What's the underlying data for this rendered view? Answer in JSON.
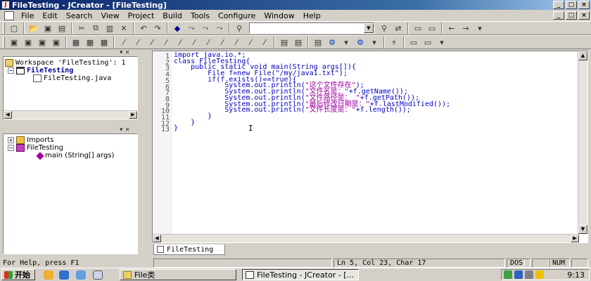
{
  "window": {
    "title": "FileTesting - JCreator - [FileTesting]",
    "min": "_",
    "max": "□",
    "close": "×"
  },
  "menu": [
    "File",
    "Edit",
    "Search",
    "View",
    "Project",
    "Build",
    "Tools",
    "Configure",
    "Window",
    "Help"
  ],
  "workspace_panel": {
    "root": "Workspace 'FileTesting': 1",
    "project": "FileTesting",
    "file": "FileTesting.java"
  },
  "class_panel": {
    "imports": "Imports",
    "class_name": "FileTesting",
    "method": "main (String[] args)"
  },
  "editor": {
    "line_numbers": [
      "1",
      "2",
      "3",
      "4",
      "5",
      "6",
      "7",
      "8",
      "9",
      "10",
      "11",
      "12",
      "13"
    ],
    "lines": [
      [
        {
          "t": "import java.io.*;",
          "c": "kw"
        }
      ],
      [
        {
          "t": "class FileTesting{",
          "c": "kw"
        }
      ],
      [
        {
          "t": "    public static void main(String args[]){",
          "c": "kw"
        }
      ],
      [
        {
          "t": "        File f=new File(\"/my/java1.txt\");",
          "c": "kw"
        }
      ],
      [
        {
          "t": "        if(f.exists()==true){",
          "c": "kw"
        }
      ],
      [
        {
          "t": "            System.out.println(",
          "c": "kw"
        },
        {
          "t": "\"这个文件存在\"",
          "c": "str"
        },
        {
          "t": ");",
          "c": "kw"
        }
      ],
      [
        {
          "t": "            System.out.println(",
          "c": "kw"
        },
        {
          "t": "\"文件名是：\"",
          "c": "str"
        },
        {
          "t": "+f.getName());",
          "c": "kw"
        }
      ],
      [
        {
          "t": "            System.out.println(",
          "c": "kw"
        },
        {
          "t": "\"文件路径是： \"",
          "c": "str"
        },
        {
          "t": "+f.getPath());",
          "c": "kw"
        }
      ],
      [
        {
          "t": "            System.out.println(",
          "c": "kw"
        },
        {
          "t": "\"最后修改日期是：\"",
          "c": "str"
        },
        {
          "t": "+f.lastModified());",
          "c": "kw"
        }
      ],
      [
        {
          "t": "            System.out.println(",
          "c": "kw"
        },
        {
          "t": "\"文件长度是：\"",
          "c": "str"
        },
        {
          "t": "+f.length());",
          "c": "kw"
        }
      ],
      [
        {
          "t": "        }",
          "c": "kw"
        }
      ],
      [
        {
          "t": "    }",
          "c": "kw"
        }
      ],
      [
        {
          "t": "}",
          "c": "kw"
        }
      ]
    ],
    "tab_label": "FileTesting"
  },
  "status": {
    "help": "For Help, press F1",
    "position": "Ln 5, Col 23, Char 17",
    "mode": "DOS",
    "num": "NUM"
  },
  "taskbar": {
    "start": "开始",
    "folder_task": "File类",
    "jcreator_task": "FileTesting - JCreator - [...",
    "clock": "9:13"
  }
}
